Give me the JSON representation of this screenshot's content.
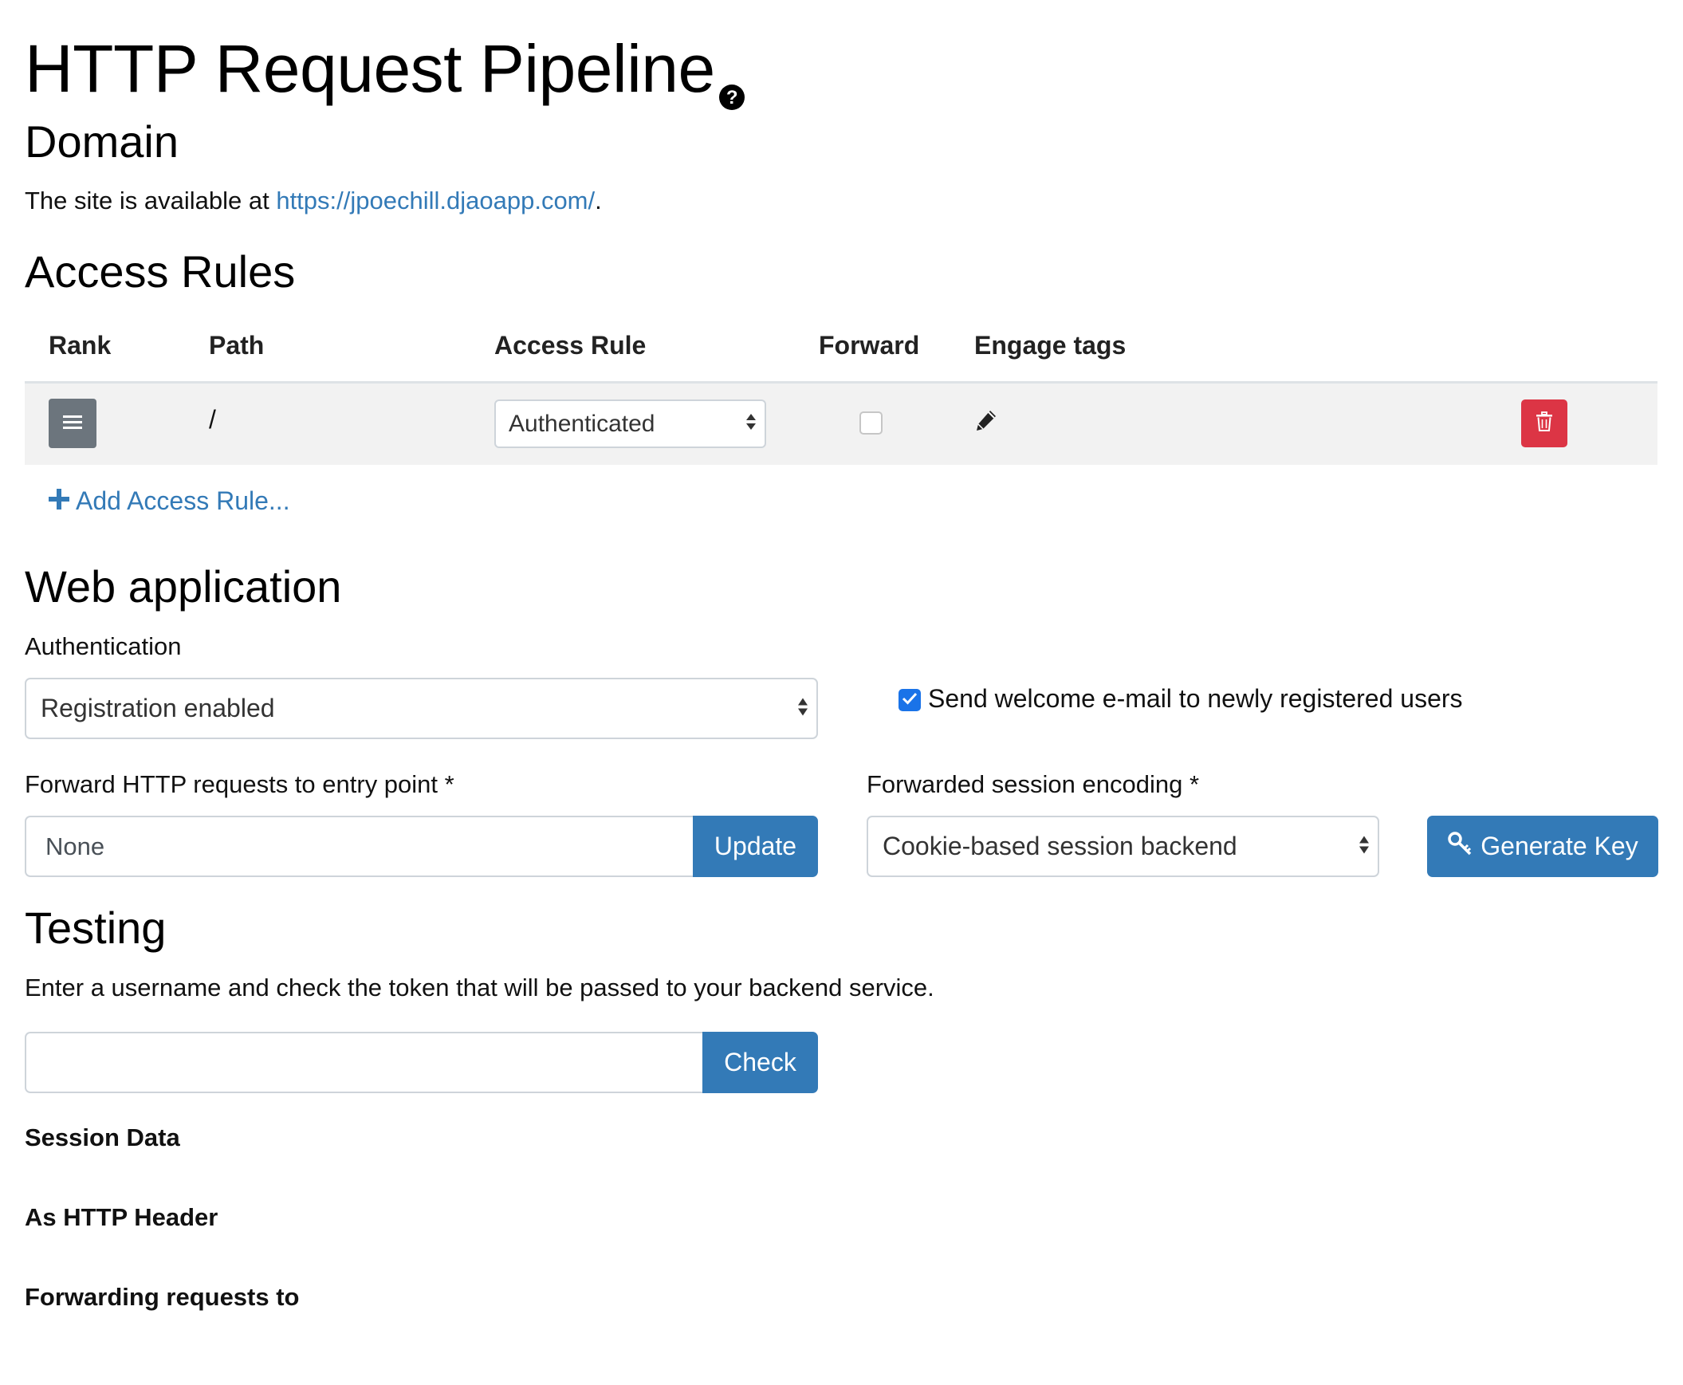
{
  "page": {
    "title": "HTTP Request Pipeline",
    "help_icon": "question-circle-icon"
  },
  "domain": {
    "heading": "Domain",
    "text_prefix": "The site is available at ",
    "url": "https://jpoechill.djaoapp.com/",
    "text_suffix": "."
  },
  "access_rules": {
    "heading": "Access Rules",
    "columns": [
      "Rank",
      "Path",
      "Access Rule",
      "Forward",
      "Engage tags"
    ],
    "rows": [
      {
        "rank_icon": "drag-handle-icon",
        "path": "/",
        "access_rule": "Authenticated",
        "forward_checked": false,
        "engage_icon": "pencil-icon",
        "delete_icon": "trash-icon"
      }
    ],
    "add_label": "Add Access Rule..."
  },
  "web_app": {
    "heading": "Web application",
    "auth_label": "Authentication",
    "auth_value": "Registration enabled",
    "welcome_label": "Send welcome e-mail to newly registered users",
    "welcome_checked": true,
    "forward_label": "Forward HTTP requests to entry point *",
    "forward_value": "None",
    "update_label": "Update",
    "encoding_label": "Forwarded session encoding *",
    "encoding_value": "Cookie-based session backend",
    "generate_label": "Generate Key",
    "generate_icon": "key-icon"
  },
  "testing": {
    "heading": "Testing",
    "description": "Enter a username and check the token that will be passed to your backend service.",
    "username_value": "",
    "check_label": "Check",
    "session_data_label": "Session Data",
    "http_header_label": "As HTTP Header",
    "forwarding_label": "Forwarding requests to"
  },
  "colors": {
    "link": "#337ab7",
    "primary_button": "#337ab7",
    "danger_button": "#dc3545",
    "secondary_button": "#6c757d",
    "checkbox_checked": "#1a73e8"
  }
}
